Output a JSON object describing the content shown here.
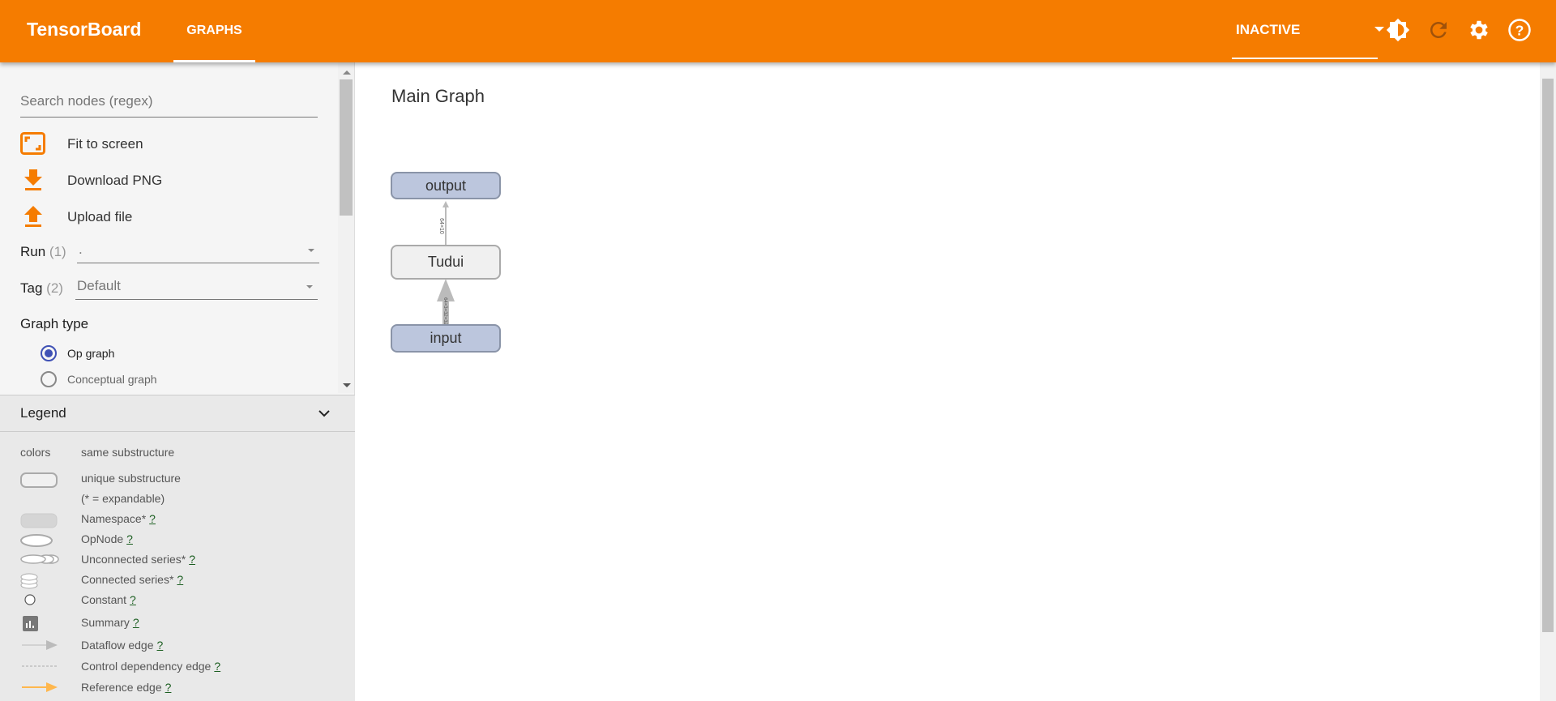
{
  "header": {
    "brand": "TensorBoard",
    "tab": "GRAPHS",
    "run_status": "INACTIVE",
    "icons": [
      "brightness-icon",
      "refresh-icon",
      "settings-icon",
      "help-icon"
    ],
    "accent": "#f57c00"
  },
  "sidebar": {
    "search_placeholder": "Search nodes (regex)",
    "actions": [
      {
        "label": "Fit to screen",
        "icon": "fit-screen-icon"
      },
      {
        "label": "Download PNG",
        "icon": "download-icon"
      },
      {
        "label": "Upload file",
        "icon": "upload-icon"
      }
    ],
    "run": {
      "label": "Run",
      "count": "(1)",
      "value": "."
    },
    "tag": {
      "label": "Tag",
      "count": "(2)",
      "value": "Default"
    },
    "graph_type": {
      "label": "Graph type",
      "options": [
        {
          "label": "Op graph",
          "selected": true
        },
        {
          "label": "Conceptual graph",
          "selected": false
        }
      ]
    }
  },
  "legend": {
    "title": "Legend",
    "rows": [
      {
        "key": "colors",
        "text": "same substructure"
      },
      {
        "text": "unique substructure"
      },
      {
        "text": "(* = expandable)"
      },
      {
        "text": "Namespace*",
        "help": "?"
      },
      {
        "text": "OpNode",
        "help": "?"
      },
      {
        "text": "Unconnected series*",
        "help": "?"
      },
      {
        "text": "Connected series*",
        "help": "?"
      },
      {
        "text": "Constant",
        "help": "?"
      },
      {
        "text": "Summary",
        "help": "?"
      },
      {
        "text": "Dataflow edge",
        "help": "?"
      },
      {
        "text": "Control dependency edge",
        "help": "?"
      },
      {
        "text": "Reference edge",
        "help": "?"
      }
    ]
  },
  "graph": {
    "title": "Main Graph",
    "nodes": [
      "output",
      "Tudui",
      "input"
    ],
    "edges": [
      {
        "label": "64×10"
      },
      {
        "label": "64×3×32×32"
      }
    ]
  }
}
